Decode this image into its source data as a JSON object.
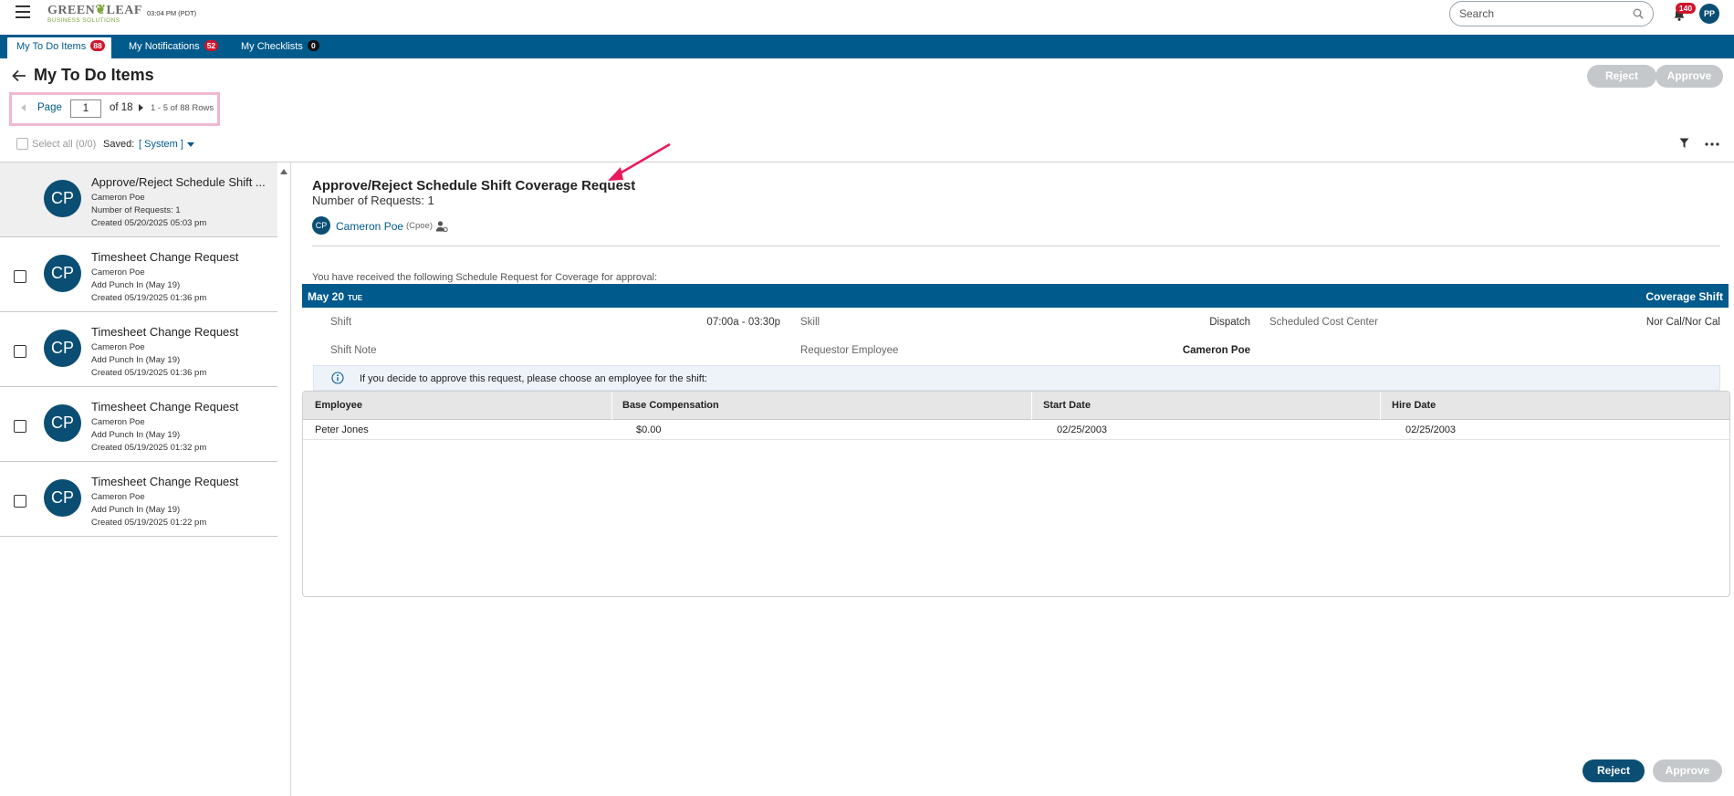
{
  "header": {
    "logo_line1_a": "GREEN",
    "logo_line1_b": "LEAF",
    "logo_line2": "BUSINESS SOLUTIONS",
    "clock": "03:04 PM (PDT)",
    "search_placeholder": "Search",
    "notification_count": "140",
    "user_initials": "PP"
  },
  "tabs": [
    {
      "label": "My To Do Items",
      "count": "88",
      "active": true
    },
    {
      "label": "My Notifications",
      "count": "52",
      "active": false
    },
    {
      "label": "My Checklists",
      "count": "0",
      "active": false
    }
  ],
  "page": {
    "title": "My To Do Items",
    "reject_label": "Reject",
    "approve_label": "Approve"
  },
  "pager": {
    "page_label": "Page",
    "current_page": "1",
    "of_label": "of 18",
    "rows_label": "1 - 5 of 88 Rows"
  },
  "list_controls": {
    "select_all": "Select all (0/0)",
    "saved_label": "Saved:",
    "saved_value": "[ System ]"
  },
  "items": [
    {
      "initials": "CP",
      "title": "Approve/Reject Schedule Shift ...",
      "line1": "Cameron Poe",
      "line2": "Number of Requests: 1",
      "line3": "Created 05/20/2025 05:03 pm",
      "selected": true
    },
    {
      "initials": "CP",
      "title": "Timesheet Change Request",
      "line1": "Cameron Poe",
      "line2": "Add Punch In (May 19)",
      "line3": "Created 05/19/2025 01:36 pm",
      "selected": false
    },
    {
      "initials": "CP",
      "title": "Timesheet Change Request",
      "line1": "Cameron Poe",
      "line2": "Add Punch In (May 19)",
      "line3": "Created 05/19/2025 01:36 pm",
      "selected": false
    },
    {
      "initials": "CP",
      "title": "Timesheet Change Request",
      "line1": "Cameron Poe",
      "line2": "Add Punch In (May 19)",
      "line3": "Created 05/19/2025 01:32 pm",
      "selected": false
    },
    {
      "initials": "CP",
      "title": "Timesheet Change Request",
      "line1": "Cameron Poe",
      "line2": "Add Punch In (May 19)",
      "line3": "Created 05/19/2025 01:22 pm",
      "selected": false
    }
  ],
  "detail": {
    "title": "Approve/Reject Schedule Shift Coverage Request",
    "subtitle": "Number of Requests: 1",
    "requester_initials": "CP",
    "requester_name": "Cameron Poe",
    "requester_code": "(Cpoe)",
    "intro": "You have received the following Schedule Request for Coverage for approval:",
    "band_date": "May 20",
    "band_dow": "TUE",
    "band_right": "Coverage Shift",
    "fields": {
      "shift_label": "Shift",
      "shift_value": "07:00a - 03:30p",
      "skill_label": "Skill",
      "skill_value": "Dispatch",
      "cost_center_label": "Scheduled Cost Center",
      "cost_center_value": "Nor Cal/Nor Cal",
      "shift_note_label": "Shift Note",
      "requestor_label": "Requestor Employee",
      "requestor_value": "Cameron Poe"
    },
    "info_text": "If you decide to approve this request, please choose an employee for the shift:",
    "grid": {
      "columns": [
        "Employee",
        "Base Compensation",
        "Start Date",
        "Hire Date"
      ],
      "rows": [
        [
          "Peter Jones",
          "$0.00",
          "02/25/2003",
          "02/25/2003"
        ]
      ]
    },
    "reject_label": "Reject",
    "approve_label": "Approve"
  },
  "colors": {
    "brand_blue": "#005a8c",
    "avatar_blue": "#0a4e74",
    "badge_red": "#d0142c",
    "disabled_gray": "#c4c8cb",
    "annotation_pink": "#e8195a"
  }
}
